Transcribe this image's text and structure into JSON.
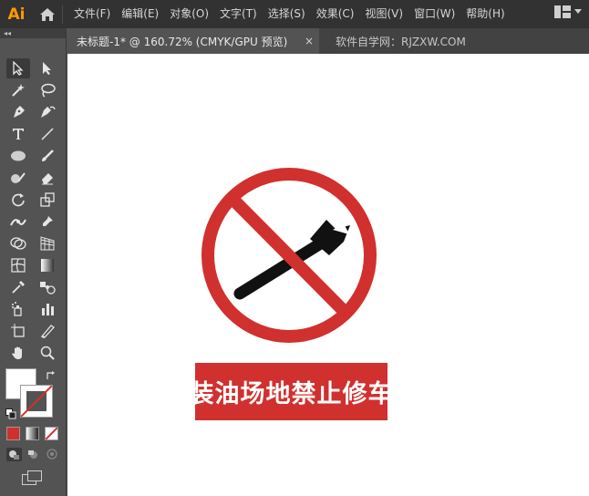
{
  "app": {
    "logo": "Ai"
  },
  "menu": [
    "文件(F)",
    "编辑(E)",
    "对象(O)",
    "文字(T)",
    "选择(S)",
    "效果(C)",
    "视图(V)",
    "窗口(W)",
    "帮助(H)"
  ],
  "tabs": {
    "active_title": "未标题-1* @ 160.72% (CMYK/GPU 预览)",
    "close_glyph": "×",
    "second_title": "软件自学网：RJZXW.COM"
  },
  "toolbar": {
    "collapse_glyph": "◂◂"
  },
  "tools": [
    "selection-tool",
    "direct-selection-tool",
    "magic-wand-tool",
    "lasso-tool",
    "pen-tool",
    "curvature-tool",
    "type-tool",
    "line-segment-tool",
    "ellipse-tool",
    "paintbrush-tool",
    "shaper-tool",
    "eraser-tool",
    "rotate-tool",
    "scale-tool",
    "width-tool",
    "puppet-warp-tool",
    "shape-builder-tool",
    "perspective-grid-tool",
    "mesh-tool",
    "gradient-tool",
    "eyedropper-tool",
    "blend-tool",
    "symbol-sprayer-tool",
    "column-graph-tool",
    "artboard-tool",
    "slice-tool",
    "hand-tool",
    "zoom-tool"
  ],
  "colors": {
    "accent_logo": "#FF9A00",
    "sign_red": "#D0302E",
    "fill_swatch": "#ffffff",
    "stroke_swatch": "#D0302E"
  },
  "artwork": {
    "sign_icon": "no-wrench-sign-icon",
    "banner_text": "装油场地禁止修车"
  }
}
